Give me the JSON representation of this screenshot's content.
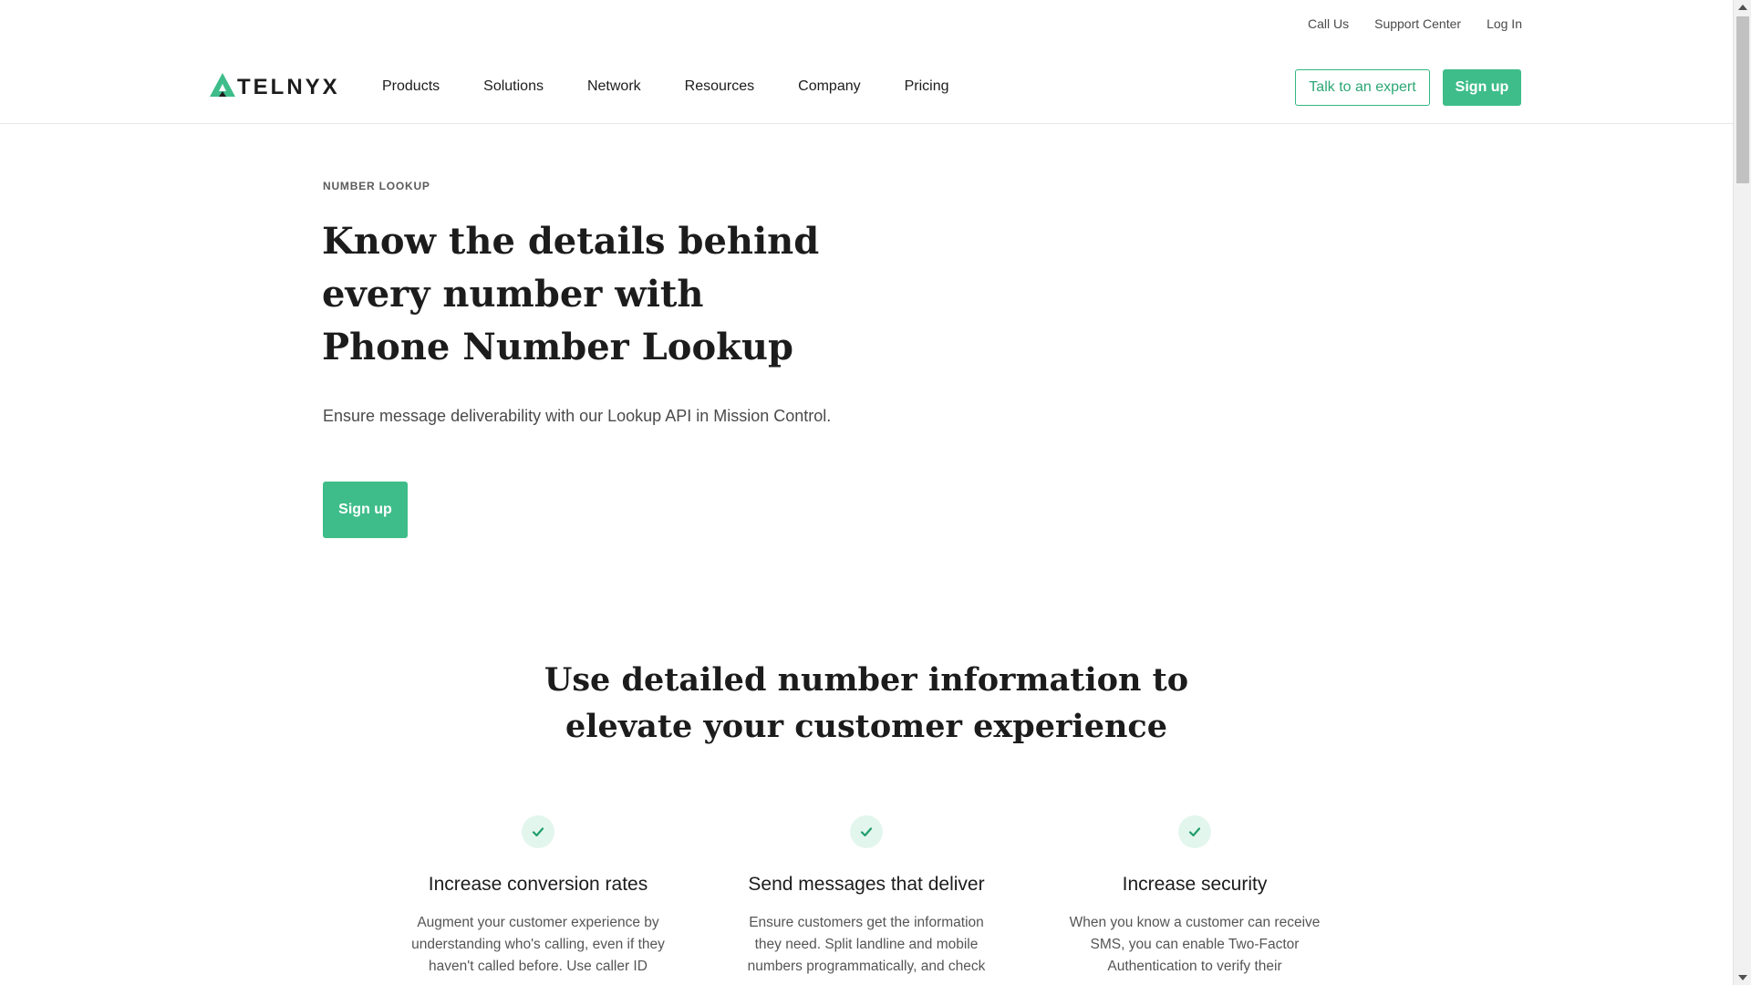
{
  "utility_nav": {
    "call_us": "Call Us",
    "support_center": "Support Center",
    "log_in": "Log In"
  },
  "logo": {
    "text": "TELNYX",
    "icon": "telnyx-triangle-logo",
    "color": "#3ebd8a"
  },
  "main_nav": {
    "items": [
      {
        "label": "Products"
      },
      {
        "label": "Solutions"
      },
      {
        "label": "Network"
      },
      {
        "label": "Resources"
      },
      {
        "label": "Company"
      },
      {
        "label": "Pricing"
      }
    ]
  },
  "header_actions": {
    "talk_to_expert": "Talk to an expert",
    "sign_up": "Sign up"
  },
  "hero": {
    "eyebrow": "NUMBER LOOKUP",
    "title": "Know the details behind every number with Phone Number Lookup",
    "subtitle": "Ensure message deliverability with our Lookup API in Mission Control.",
    "cta": "Sign up"
  },
  "section": {
    "title": "Use detailed number information to elevate your customer experience"
  },
  "features": [
    {
      "icon": "check-icon",
      "title": "Increase conversion rates",
      "body": "Augment your customer experience by understanding who's calling, even if they haven't called before. Use caller ID"
    },
    {
      "icon": "check-icon",
      "title": "Send messages that deliver",
      "body": "Ensure customers get the information they need. Split landline and mobile numbers programmatically, and check"
    },
    {
      "icon": "check-icon",
      "title": "Increase security",
      "body": "When you know a customer can receive SMS, you can enable Two-Factor Authentication to verify their"
    }
  ],
  "colors": {
    "brand_green": "#3ebd8a",
    "text_dark": "#1c1c1c",
    "check_bg": "#e3f6ee"
  }
}
